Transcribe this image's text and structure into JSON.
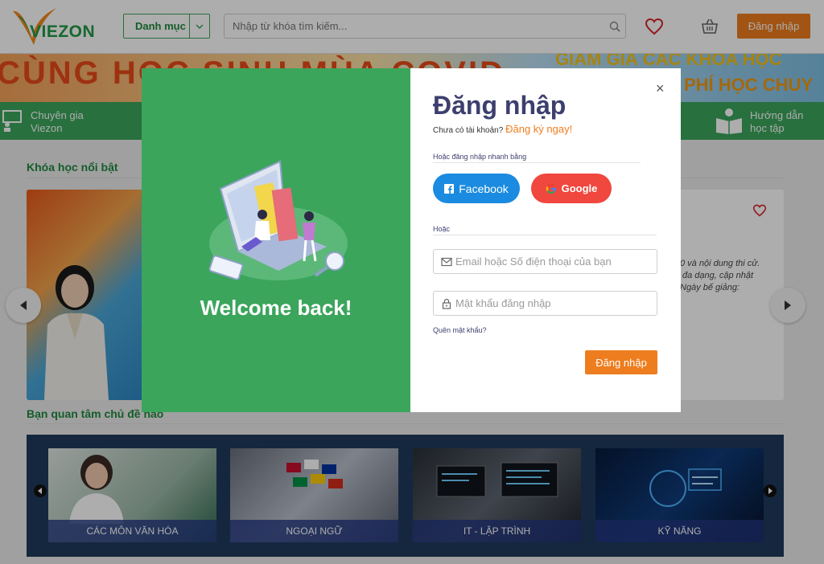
{
  "header": {
    "logo_text": "VIEZON",
    "category_label": "Danh mục",
    "search_placeholder": "Nhập từ khóa tìm kiếm...",
    "login_label": "Đăng nhập"
  },
  "banner": {
    "left_text": "CÙNG HỌC SINH MÙA COVID",
    "right_text_1": "GIẢM GIÁ CÁC KHÓA HỌC",
    "right_text_2": "PHÍ HỌC CHUY"
  },
  "green_bar": {
    "left_item_line1": "Chuyên gia",
    "left_item_line2": "Viezon",
    "right_item_line1": "Hướng dẫn",
    "right_item_line2": "học tập"
  },
  "featured": {
    "section_title": "Khóa học nổi bật",
    "desc_line1": "0 và nội dung thi cử.",
    "desc_line2": "đa dạng, cập nhật",
    "desc_line3": "Ngày bế giảng:"
  },
  "topics": {
    "section_title": "Bạn quan tâm chủ đề nào",
    "items": [
      {
        "label": "CÁC MÔN VĂN HÓA"
      },
      {
        "label": "NGOẠI NGỮ"
      },
      {
        "label": "IT - LẬP TRÌNH"
      },
      {
        "label": "KỸ NĂNG"
      }
    ]
  },
  "modal": {
    "welcome": "Welcome back!",
    "title": "Đăng nhập",
    "no_account": "Chưa có tài khoản?",
    "register_link": "Đăng ký ngay!",
    "quick_login": "Hoặc đăng nhập nhanh bằng",
    "facebook_label": "Facebook",
    "google_label": "Google",
    "or_label": "Hoặc",
    "email_placeholder": "Email hoặc Số điện thoại của bạn",
    "password_placeholder": "Mật khẩu đăng nhập",
    "forgot_password": "Quên mật khẩu?",
    "login_button": "Đăng nhập",
    "close_symbol": "×"
  },
  "colors": {
    "brand_green": "#3ba55c",
    "brand_orange": "#ed7d1e",
    "facebook_blue": "#1a8be0",
    "google_red": "#f0473e",
    "title_navy": "#3c3f6e"
  }
}
